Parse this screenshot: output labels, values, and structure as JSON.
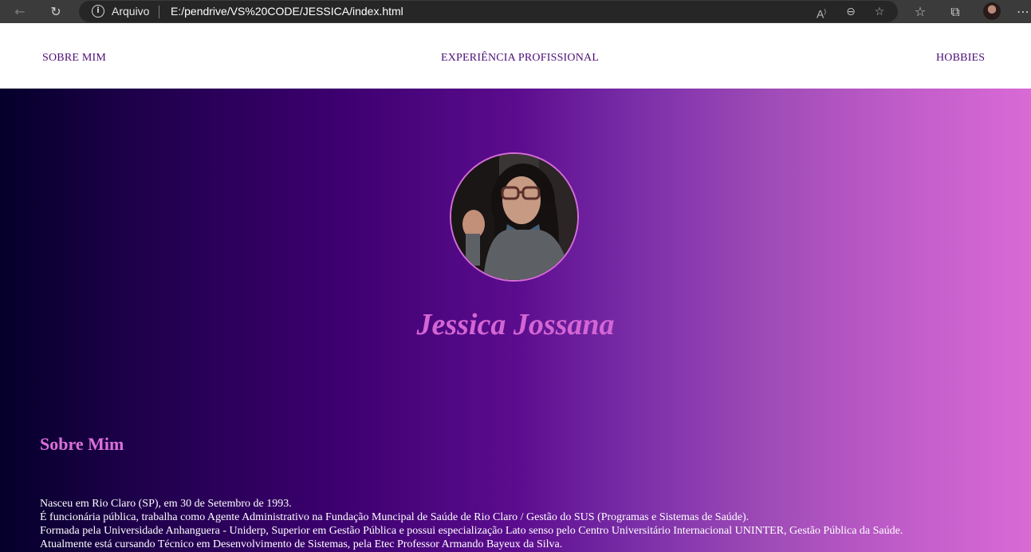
{
  "browser": {
    "address_label": "Arquivo",
    "url": "E:/pendrive/VS%20CODE/JESSICA/index.html",
    "icons": [
      "back-icon",
      "refresh-icon",
      "info-icon",
      "read-aloud-icon",
      "zoom-out-icon",
      "add-favorite-icon",
      "favorites-icon",
      "collections-icon",
      "profile-avatar",
      "more-icon"
    ]
  },
  "nav": {
    "items": [
      {
        "label": "SOBRE MIM"
      },
      {
        "label": "EXPERIÊNCIA PROFISSIONAL"
      },
      {
        "label": "HOBBIES"
      }
    ]
  },
  "hero": {
    "name": "Jessica Jossana"
  },
  "about": {
    "title": "Sobre Mim",
    "lines": [
      "Nasceu em Rio Claro (SP), em 30 de Setembro de 1993.",
      "É funcionária pública, trabalha como Agente Administrativo na Fundação Muncipal de Saúde de Rio Claro / Gestão do SUS (Programas e Sistemas de Saúde).",
      "Formada pela Universidade Anhanguera - Uniderp, Superior em Gestão Pública e possui especialização Lato senso pelo Centro Universitário Internacional UNINTER, Gestão Pública da Saúde.",
      "Atualmente está cursando Técnico em Desenvolvimento de Sistemas, pela Etec Professor Armando Bayeux da Silva."
    ]
  },
  "colors": {
    "nav_text": "#4b0d76",
    "accent_pink": "#d465d4",
    "gradient_start": "#04002a",
    "gradient_end": "#d96ad6"
  }
}
